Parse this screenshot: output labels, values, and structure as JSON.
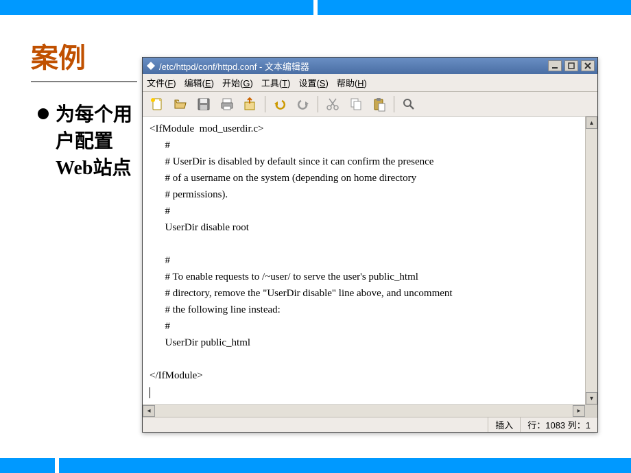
{
  "slide": {
    "heading": "案例",
    "bullet": "为每个用户配置Web站点"
  },
  "window": {
    "title": "/etc/httpd/conf/httpd.conf - 文本编辑器",
    "menus": {
      "file": "文件(",
      "file_key": "F",
      "edit": "编辑(",
      "edit_key": "E",
      "start": "开始(",
      "start_key": "G",
      "tools": "工具(",
      "tools_key": "T",
      "settings": "设置(",
      "settings_key": "S",
      "help": "帮助(",
      "help_key": "H",
      "close_paren": ")"
    },
    "editor_lines": [
      "<IfModule  mod_userdir.c>",
      "      #",
      "      # UserDir is disabled by default since it can confirm the presence",
      "      # of a username on the system (depending on home directory",
      "      # permissions).",
      "      #",
      "      UserDir disable root",
      "",
      "      #",
      "      # To enable requests to /~user/ to serve the user's public_html",
      "      # directory, remove the \"UserDir disable\" line above, and uncomment",
      "      # the following line instead:",
      "      #",
      "      UserDir public_html",
      "",
      "</IfModule>"
    ],
    "status": {
      "mode": "插入",
      "position": "行：1083  列：1"
    }
  }
}
